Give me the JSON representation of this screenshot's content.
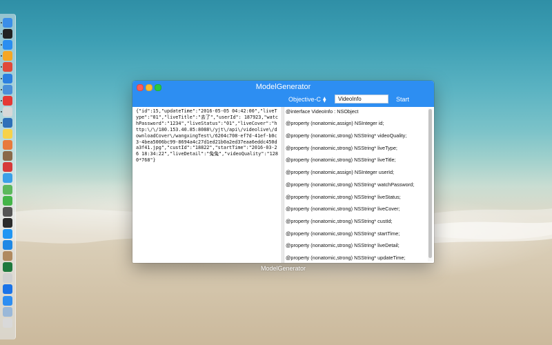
{
  "window": {
    "title": "ModelGenerator",
    "language": "Objective-C",
    "class_name": "VideoInfo",
    "start_label": "Start",
    "caption": "ModelGenerator"
  },
  "input_json": "{\"id\":15,\"updateTime\":\"2016-05-05 04:42:00\",\"liveType\":\"01\",\"liveTitle\":\"去了\",\"userId\": 187923,\"watchPassword\":\"1234\",\"liveStatus\":\"01\",\"liveCover\":\"http:\\/\\/180.153.40.85:8088\\/yjt\\/api\\/videolive\\/downloadCover\\/wangxingTest\\/6204c708-ef7d-41ef-b0c3-4bea5006bc99-8694a4c27d1ed21b0a2ed37eaa6eddc450da3f41.jpg\",\"custId\":\"18822\",\"startTime\":\"2016-03-26 18:34:22\",\"liveDetail\":\"兔兔\",\"videoQuality\":\"1280*768\"}",
  "output_lines": [
    "@interface VideoInfo : NSObject",
    "@property (nonatomic,assign) NSInteger id;",
    "@property (nonatomic,strong) NSString* videoQuality;",
    "@property (nonatomic,strong) NSString* liveType;",
    "@property (nonatomic,strong) NSString* liveTitle;",
    "@property (nonatomic,assign) NSInteger userId;",
    "@property (nonatomic,strong) NSString* watchPassword;",
    "@property (nonatomic,strong) NSString* liveStatus;",
    "@property (nonatomic,strong) NSString* liveCover;",
    "@property (nonatomic,strong) NSString* custId;",
    "@property (nonatomic,strong) NSString* startTime;",
    "@property (nonatomic,strong) NSString* liveDetail;",
    "@property (nonatomic,strong) NSString* updateTime;"
  ],
  "dock": {
    "icons": [
      {
        "name": "finder-icon",
        "color": "#3b8ee8"
      },
      {
        "name": "terminal-icon",
        "color": "#222222"
      },
      {
        "name": "app-store-icon",
        "color": "#2a8ef0"
      },
      {
        "name": "sketch-icon",
        "color": "#f5a623"
      },
      {
        "name": "chrome-icon",
        "color": "#e04a3a"
      },
      {
        "name": "safari-icon",
        "color": "#2c80e0"
      },
      {
        "name": "mail-icon",
        "color": "#4a90d9"
      },
      {
        "name": "qq-icon",
        "color": "#e53935"
      },
      {
        "name": "calendar-icon",
        "color": "#d8d8d8"
      },
      {
        "name": "xcode-icon",
        "color": "#2d6fb8"
      },
      {
        "name": "notes-icon",
        "color": "#f7d24a"
      },
      {
        "name": "photos-icon",
        "color": "#e87a3c"
      },
      {
        "name": "preview-icon",
        "color": "#8a6a4a"
      },
      {
        "name": "sequel-icon",
        "color": "#d63a3a"
      },
      {
        "name": "messages-icon",
        "color": "#3aa0e8"
      },
      {
        "name": "maps-icon",
        "color": "#5cb85c"
      },
      {
        "name": "wechat-icon",
        "color": "#44b549"
      },
      {
        "name": "instruments-icon",
        "color": "#555555"
      },
      {
        "name": "dash-icon",
        "color": "#2b2b2b"
      },
      {
        "name": "browser-icon",
        "color": "#2196f3"
      },
      {
        "name": "vscode-icon",
        "color": "#1e88e5"
      },
      {
        "name": "paw-icon",
        "color": "#b08a60"
      },
      {
        "name": "excel-icon",
        "color": "#1f7a3e"
      },
      {
        "name": "jenkins-icon",
        "color": "#d0d0d0"
      },
      {
        "name": "teamviewer-icon",
        "color": "#1a73e8"
      },
      {
        "name": "vpn-icon",
        "color": "#2d8ef2"
      },
      {
        "name": "downloads-icon",
        "color": "#9ab8d8"
      },
      {
        "name": "trash-icon",
        "color": "#d9d9d9"
      }
    ]
  }
}
